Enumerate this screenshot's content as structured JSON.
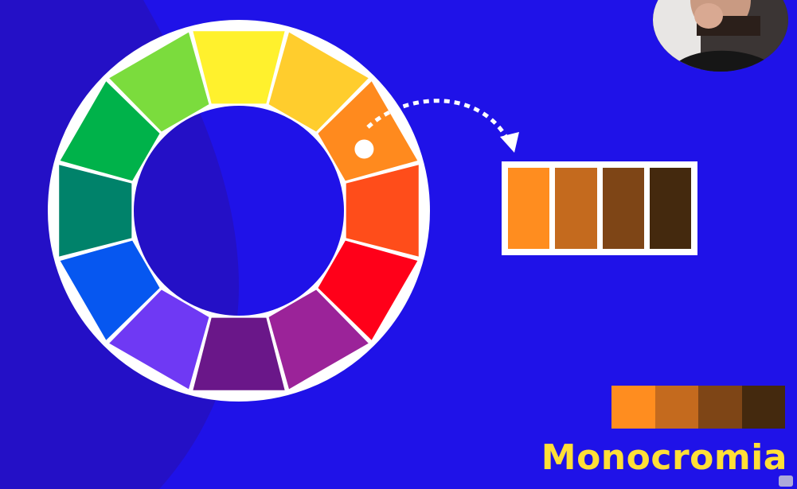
{
  "slide": {
    "caption": "Monocromia",
    "background_color": "#1f12e8",
    "background_shade_color": "#2410c6",
    "caption_color": "#ffdf37"
  },
  "color_wheel": {
    "segments": [
      {
        "name": "yellow",
        "color": "#fff12d"
      },
      {
        "name": "yellow-orange",
        "color": "#ffcd2d"
      },
      {
        "name": "orange",
        "color": "#ff8a1e"
      },
      {
        "name": "red-orange",
        "color": "#ff4d1a"
      },
      {
        "name": "red",
        "color": "#ff0019"
      },
      {
        "name": "red-violet",
        "color": "#9b2399"
      },
      {
        "name": "violet",
        "color": "#6a1789"
      },
      {
        "name": "blue-violet",
        "color": "#6f39f4"
      },
      {
        "name": "blue",
        "color": "#0657f0"
      },
      {
        "name": "blue-green",
        "color": "#00826a"
      },
      {
        "name": "green",
        "color": "#00b24a"
      },
      {
        "name": "yellow-green",
        "color": "#7bdc3d"
      }
    ],
    "selected": "orange",
    "border_color": "#ffffff"
  },
  "palette": {
    "swatches": [
      {
        "color": "#ff8d1f"
      },
      {
        "color": "#c46a1e"
      },
      {
        "color": "#7e4516"
      },
      {
        "color": "#44290e"
      }
    ]
  },
  "icons": {
    "pointer": "dotted-arrow-icon",
    "selector": "selection-dot-icon",
    "corner": "player-control-icon"
  }
}
